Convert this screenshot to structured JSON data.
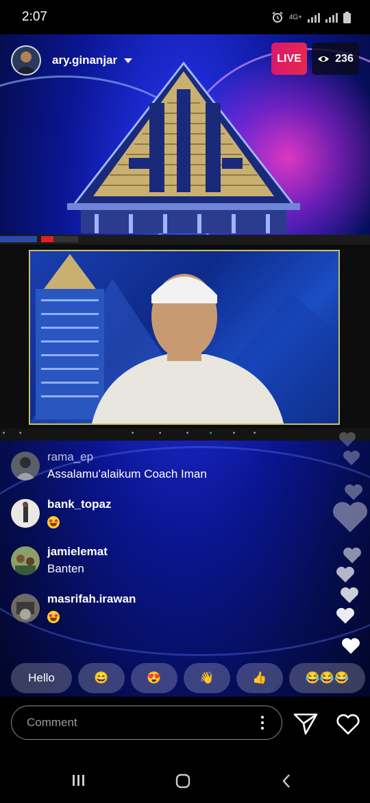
{
  "status": {
    "time": "2:07",
    "network": "4G+"
  },
  "host": {
    "username": "ary.ginanjar"
  },
  "live": {
    "label": "LIVE",
    "viewers": "236"
  },
  "comments": [
    {
      "user": "rama_ep",
      "text": "Assalamu'alaikum Coach Iman",
      "emoji": false
    },
    {
      "user": "bank_topaz",
      "text": "",
      "emoji": true
    },
    {
      "user": "jamielemat",
      "text": "Banten",
      "emoji": false
    },
    {
      "user": "masrifah.irawan",
      "text": "",
      "emoji": true
    }
  ],
  "quick_replies": [
    "Hello",
    "😄",
    "😍",
    "👋",
    "👍",
    "😂😂😂"
  ],
  "comment_box": {
    "placeholder": "Comment"
  },
  "colors": {
    "live_badge": "#e0245e",
    "background": "#0a1590"
  },
  "icons": [
    "eye-icon",
    "dropdown-chevron-icon",
    "more-options-icon",
    "send-icon",
    "like-heart-icon",
    "recents-nav-icon",
    "home-nav-icon",
    "back-nav-icon"
  ]
}
